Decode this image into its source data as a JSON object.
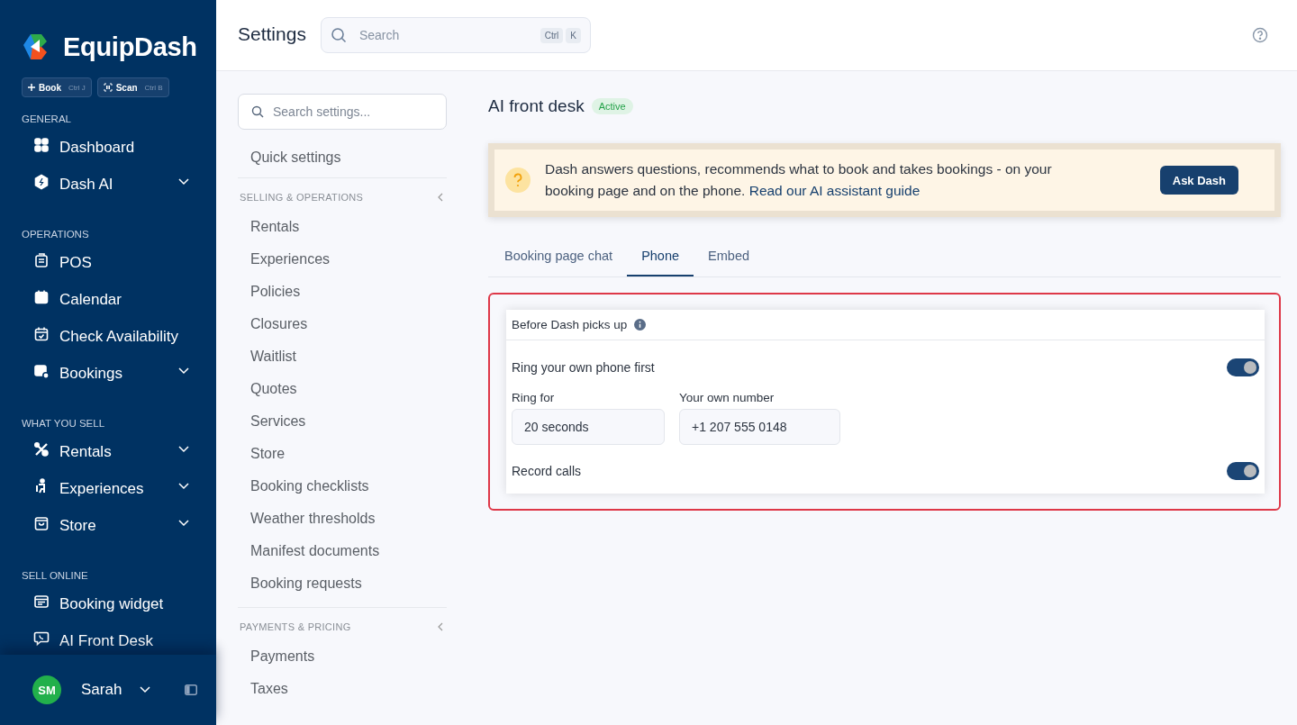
{
  "brand": {
    "name": "EquipDash"
  },
  "quick_actions": [
    {
      "label": "Book",
      "shortcut": "Ctrl J"
    },
    {
      "label": "Scan",
      "shortcut": "Ctrl B"
    }
  ],
  "nav_sections": [
    {
      "title": "GENERAL",
      "items": [
        {
          "label": "Dashboard",
          "expandable": false
        },
        {
          "label": "Dash AI",
          "expandable": true
        }
      ]
    },
    {
      "title": "OPERATIONS",
      "items": [
        {
          "label": "POS",
          "expandable": false
        },
        {
          "label": "Calendar",
          "expandable": false
        },
        {
          "label": "Check Availability",
          "expandable": false
        },
        {
          "label": "Bookings",
          "expandable": true
        }
      ]
    },
    {
      "title": "WHAT YOU SELL",
      "items": [
        {
          "label": "Rentals",
          "expandable": true
        },
        {
          "label": "Experiences",
          "expandable": true
        },
        {
          "label": "Store",
          "expandable": true
        }
      ]
    },
    {
      "title": "SELL ONLINE",
      "items": [
        {
          "label": "Booking widget",
          "expandable": false
        },
        {
          "label": "AI Front Desk",
          "expandable": false
        }
      ]
    }
  ],
  "user": {
    "initials": "SM",
    "name": "Sarah"
  },
  "header": {
    "title": "Settings",
    "search": {
      "placeholder": "Search",
      "keys": [
        "Ctrl",
        "K"
      ]
    }
  },
  "settings_nav": {
    "search": {
      "placeholder": "Search settings..."
    },
    "quick_link": "Quick settings",
    "groups": [
      {
        "title": "SELLING & OPERATIONS",
        "items": [
          "Rentals",
          "Experiences",
          "Policies",
          "Closures",
          "Waitlist",
          "Quotes",
          "Services",
          "Store",
          "Booking checklists",
          "Weather thresholds",
          "Manifest documents",
          "Booking requests"
        ]
      },
      {
        "title": "PAYMENTS & PRICING",
        "items": [
          "Payments",
          "Taxes"
        ]
      }
    ]
  },
  "page": {
    "title": "AI front desk",
    "status": "Active",
    "notice": {
      "text": "Dash answers questions, recommends what to book and takes bookings - on your booking page and on the phone.",
      "link": "Read our AI assistant guide",
      "button": "Ask Dash"
    },
    "tabs": [
      {
        "label": "Booking page chat",
        "selected": false
      },
      {
        "label": "Phone",
        "selected": true
      },
      {
        "label": "Embed",
        "selected": false
      }
    ],
    "panel": {
      "highlighted": true,
      "title": "Before Dash picks up",
      "rows": [
        {
          "kind": "toggle",
          "label": "Ring your own phone first",
          "on": true
        },
        {
          "kind": "fields",
          "fields": [
            {
              "label": "Ring for",
              "value": "20 seconds"
            },
            {
              "label": "Your own number",
              "value": "+1 207 555 0148"
            }
          ]
        },
        {
          "kind": "toggle",
          "label": "Record calls",
          "on": true
        }
      ]
    }
  }
}
